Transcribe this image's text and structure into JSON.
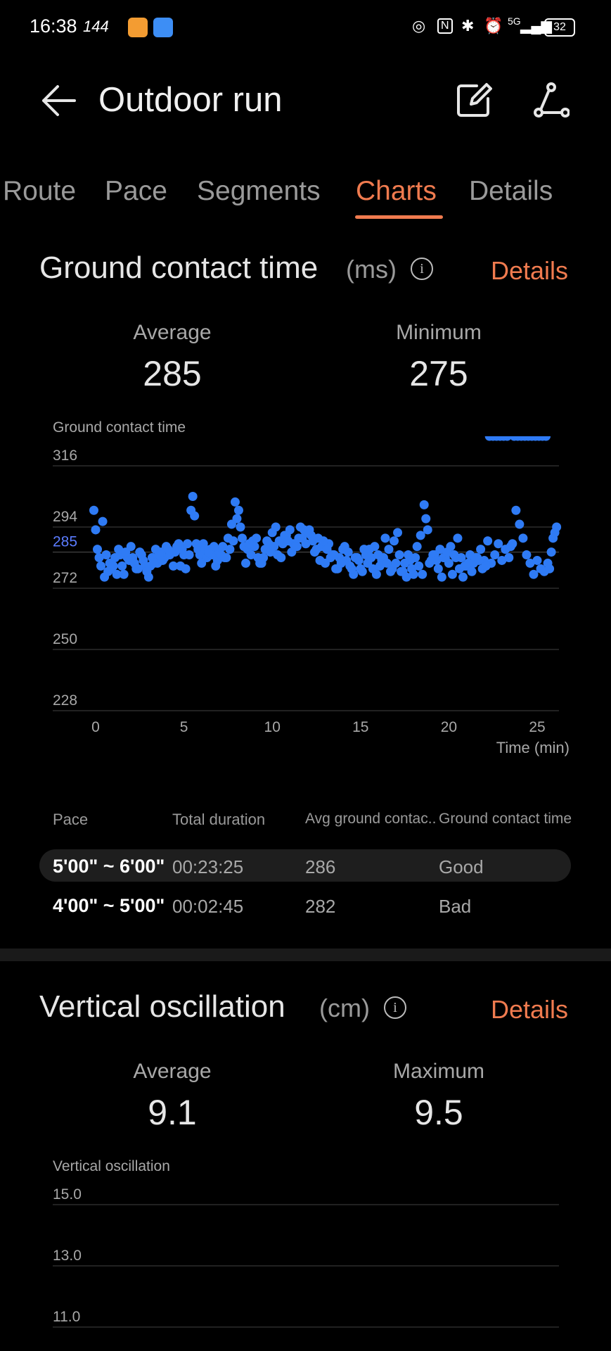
{
  "status_bar": {
    "time": "16:38",
    "refresh": "144",
    "network": "5G",
    "battery": "32"
  },
  "header": {
    "title": "Outdoor run",
    "icons": [
      "back-arrow-icon",
      "edit-icon",
      "route-share-icon"
    ]
  },
  "tabs": [
    {
      "label": "Route",
      "active": false
    },
    {
      "label": "Pace",
      "active": false
    },
    {
      "label": "Segments",
      "active": false
    },
    {
      "label": "Charts",
      "active": true
    },
    {
      "label": "Details",
      "active": false
    }
  ],
  "gct_section": {
    "title": "Ground contact time",
    "unit": "(ms)",
    "details": "Details",
    "average_label": "Average",
    "average_value": "285",
    "minimum_label": "Minimum",
    "minimum_value": "275",
    "chart_name": "Ground contact time"
  },
  "table": {
    "headers": [
      "Pace",
      "Total duration",
      "Avg ground contac...",
      "Ground contact time"
    ],
    "rows": [
      {
        "pace": "5'00\" ~ 6'00\"",
        "duration": "00:23:25",
        "avg": "286",
        "rating": "Good",
        "highlighted": true
      },
      {
        "pace": "4'00\" ~ 5'00\"",
        "duration": "00:02:45",
        "avg": "282",
        "rating": "Bad",
        "highlighted": false
      }
    ]
  },
  "vo_section": {
    "title": "Vertical oscillation",
    "unit": "(cm)",
    "details": "Details",
    "average_label": "Average",
    "average_value": "9.1",
    "maximum_label": "Maximum",
    "maximum_value": "9.5",
    "chart_name": "Vertical oscillation"
  },
  "colors": {
    "accent": "#f07b4f",
    "point": "#2f7bf5",
    "avg_label": "#5b7cff"
  },
  "chart_data": [
    {
      "type": "scatter",
      "title": "Ground contact time",
      "xlabel": "Time (min)",
      "ylabel": "",
      "xlim": [
        0,
        26
      ],
      "ylim": [
        228,
        316
      ],
      "y_ticks": [
        228,
        250,
        272,
        285,
        294,
        316
      ],
      "y_ticks_display": [
        "228",
        "250",
        "272",
        "285",
        "294",
        "316"
      ],
      "highlighted_tick": "285",
      "x_ticks": [
        0,
        5,
        10,
        15,
        20,
        25
      ],
      "x_ticks_display": [
        "0",
        "5",
        "10",
        "15",
        "20",
        "25"
      ],
      "grid": true,
      "series": [
        {
          "values_x": [
            -0.1,
            0.0,
            0.1,
            0.3,
            0.5,
            0.6,
            0.8,
            0.9,
            1.1,
            1.3,
            1.5,
            1.6,
            1.8,
            2.0,
            2.2,
            2.3,
            2.5,
            2.7,
            2.8,
            3.0,
            3.2,
            3.4,
            3.5,
            3.7,
            3.9,
            4.0,
            4.2,
            4.4,
            4.5,
            4.7,
            4.9,
            5.0,
            5.2,
            5.4,
            5.5,
            5.6,
            5.7,
            5.8,
            5.9,
            6.1,
            6.3,
            6.5,
            6.6,
            6.8,
            7.0,
            7.2,
            7.4,
            7.5,
            7.7,
            7.9,
            8.0,
            8.1,
            8.2,
            8.3,
            8.4,
            8.6,
            8.8,
            9.0,
            9.2,
            9.4,
            9.6,
            9.8,
            10.0,
            10.2,
            10.4,
            10.6,
            10.8,
            11.0,
            11.2,
            11.4,
            11.6,
            11.8,
            12.0,
            12.2,
            12.4,
            12.6,
            12.8,
            13.0,
            13.2,
            13.4,
            13.6,
            13.8,
            14.0,
            14.2,
            14.4,
            14.6,
            14.8,
            15.0,
            15.2,
            15.4,
            15.6,
            15.8,
            16.0,
            16.2,
            16.4,
            16.6,
            16.8,
            17.0,
            17.2,
            17.4,
            17.6,
            17.8,
            18.0,
            18.2,
            18.4,
            18.6,
            18.7,
            18.8,
            19.0,
            19.2,
            19.4,
            19.6,
            19.8,
            20.0,
            20.2,
            20.4,
            20.6,
            20.8,
            21.0,
            21.2,
            21.4,
            21.6,
            21.8,
            22.0,
            22.2,
            22.4,
            22.6,
            22.8,
            23.0,
            23.2,
            23.4,
            23.5,
            23.6,
            23.8,
            24.0,
            24.2,
            24.4,
            24.6,
            24.8,
            25.0,
            25.2,
            25.4,
            25.6,
            25.8,
            26.0,
            26.1,
            25.9,
            25.7,
            0.2,
            0.4,
            0.7,
            1.0,
            1.2,
            1.4,
            1.7,
            1.9,
            2.1,
            2.4,
            2.6,
            2.9,
            3.1,
            3.3,
            3.6,
            3.8,
            4.1,
            4.3,
            4.6,
            4.8,
            5.1,
            5.3,
            6.0,
            6.2,
            6.4,
            6.7,
            6.9,
            7.1,
            7.3,
            7.6,
            7.8,
            8.5,
            8.7,
            8.9,
            9.1,
            9.3,
            9.5,
            9.7,
            9.9,
            10.1,
            10.3,
            10.5,
            10.7,
            10.9,
            11.1,
            11.3,
            11.5,
            11.7,
            11.9,
            12.1,
            12.3,
            12.5,
            12.7,
            12.9,
            13.1,
            13.3,
            13.5,
            13.7,
            13.9,
            14.1,
            14.3,
            14.5,
            14.7,
            14.9,
            15.1,
            15.3,
            15.5,
            15.7,
            15.9,
            16.1,
            16.3,
            16.5,
            16.7,
            16.9,
            17.1,
            17.3,
            17.5,
            17.7,
            17.9,
            18.1,
            18.3,
            18.5,
            18.9,
            19.1,
            19.3,
            19.5,
            19.7,
            19.9,
            20.1,
            20.3,
            20.5,
            20.7,
            20.9,
            21.1,
            21.3,
            21.5,
            21.7,
            21.9,
            22.1,
            22.3,
            22.5,
            22.7,
            22.9,
            23.1,
            23.3,
            23.7,
            23.9,
            24.1,
            24.3,
            24.5,
            24.7,
            24.9,
            25.1,
            25.3,
            25.5
          ],
          "values_y": [
            300,
            293,
            286,
            280,
            276,
            284,
            281,
            279,
            283,
            286,
            280,
            277,
            283,
            287,
            281,
            279,
            285,
            282,
            280,
            276,
            283,
            286,
            281,
            285,
            283,
            287,
            284,
            280,
            285,
            288,
            286,
            284,
            288,
            300,
            305,
            298,
            288,
            286,
            284,
            288,
            283,
            286,
            284,
            280,
            285,
            287,
            283,
            290,
            295,
            303,
            297,
            300,
            294,
            290,
            287,
            286,
            284,
            287,
            283,
            281,
            286,
            288,
            292,
            294,
            289,
            288,
            291,
            293,
            288,
            287,
            294,
            293,
            292,
            291,
            285,
            290,
            287,
            281,
            288,
            284,
            279,
            283,
            286,
            282,
            280,
            277,
            283,
            279,
            286,
            281,
            283,
            287,
            284,
            282,
            290,
            286,
            279,
            281,
            284,
            278,
            276,
            282,
            277,
            287,
            291,
            302,
            297,
            293,
            282,
            284,
            279,
            276,
            283,
            281,
            277,
            283,
            279,
            276,
            280,
            284,
            281,
            283,
            286,
            282,
            289,
            281,
            284,
            288,
            282,
            286,
            283,
            287,
            288,
            300,
            295,
            290,
            284,
            281,
            277,
            282,
            279,
            278,
            281,
            285,
            292,
            294,
            290,
            279,
            283,
            296,
            278,
            280,
            277,
            284,
            285,
            282,
            283,
            279,
            284,
            278,
            280,
            281,
            284,
            282,
            286,
            285,
            287,
            280,
            279,
            284,
            281,
            286,
            285,
            287,
            282,
            284,
            283,
            286,
            289,
            281,
            288,
            289,
            290,
            281,
            283,
            289,
            285,
            287,
            284,
            283,
            291,
            289,
            285,
            287,
            290,
            290,
            288,
            293,
            289,
            286,
            282,
            289,
            286,
            283,
            284,
            279,
            281,
            287,
            285,
            279,
            283,
            282,
            278,
            284,
            286,
            279,
            277,
            280,
            283,
            281,
            278,
            289,
            292,
            278,
            281,
            284,
            279,
            283,
            280,
            277,
            281,
            284,
            282,
            286,
            283,
            285,
            287,
            284,
            290,
            283,
            280,
            281,
            278,
            283,
            282,
            279,
            280
          ]
        }
      ]
    },
    {
      "type": "scatter",
      "title": "Vertical oscillation",
      "xlabel": "",
      "ylabel": "",
      "ylim": [
        11.0,
        15.0
      ],
      "y_ticks": [
        15.0,
        13.0,
        11.0
      ],
      "y_ticks_display": [
        "15.0",
        "13.0",
        "11.0"
      ],
      "grid": true,
      "series": []
    }
  ]
}
